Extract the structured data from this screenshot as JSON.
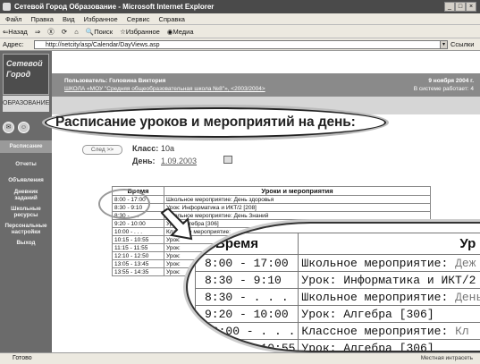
{
  "window": {
    "title": "Сетевой Город Образование - Microsoft Internet Explorer"
  },
  "menu": [
    "Файл",
    "Правка",
    "Вид",
    "Избранное",
    "Сервис",
    "Справка"
  ],
  "toolbar": [
    "⇐Назад",
    "⇒",
    "Ⓧ",
    "⟳",
    "⌂",
    "🔍Поиск",
    "☆Избранное",
    "◉Медиа"
  ],
  "address": {
    "label": "Адрес:",
    "url": "http://netcity/asp/Calendar/DayViews.asp",
    "links": "Ссылки"
  },
  "logo": {
    "line1": "Сетевой",
    "line2": "Город",
    "tab": "ОБРАЗОВАНИЕ"
  },
  "nav": [
    "Расписание",
    "Отчеты",
    "Объявления",
    "Дневник заданий",
    "Школьные ресурсы",
    "Персональные настройки",
    "Выход"
  ],
  "header": {
    "user": "Пользователь: Головина Виктория",
    "school": "ШКОЛА «МОУ \"Средняя общеобразовательная школа №8\"», <2003/2004>",
    "date": "9 ноября 2004 г.",
    "online": "В системе работает: 4"
  },
  "page": {
    "heading": "Расписание уроков и мероприятий на день:",
    "next": "След >>",
    "class_label": "Класс:",
    "class_value": "10а",
    "day_label": "День:",
    "day_value": "1.09.2003"
  },
  "small_table": {
    "headers": [
      "Время",
      "Уроки и мероприятия"
    ],
    "rows": [
      [
        "8:00 - 17:00",
        "Школьное мероприятие: День здоровья"
      ],
      [
        "8:30 - 9:10",
        "Урок: Информатика и ИКТ/2 [208]"
      ],
      [
        "8:30 - . . .",
        "Школьное мероприятие: День Знаний"
      ],
      [
        "9:20 - 10:00",
        "Урок: Алгебра [306]"
      ],
      [
        "10:00 - . . .",
        "Классное мероприятие:"
      ],
      [
        "10:15 - 10:55",
        "Урок:"
      ],
      [
        "11:15 - 11:55",
        "Урок:"
      ],
      [
        "12:10 - 12:50",
        "Урок:"
      ],
      [
        "13:05 - 13:45",
        "Урок:"
      ],
      [
        "13:55 - 14:35",
        "Урок:"
      ]
    ]
  },
  "zoom_table": {
    "headers": [
      "Время",
      "Ур"
    ],
    "rows": [
      [
        "8:00 - 17:00",
        "Школьное мероприятие: ",
        "Дeж"
      ],
      [
        "8:30 - 9:10",
        "Урок: Информатика и ИКТ/2 [2",
        ""
      ],
      [
        "8:30 - . . .",
        "Школьное мероприятие: ",
        "День З"
      ],
      [
        "9:20 - 10:00",
        "Урок: Алгебра [306]",
        ""
      ],
      [
        "10:00 - . . .",
        "Классное мероприятие: ",
        "Кл"
      ],
      [
        "10:15 - 10:55",
        "Урок: Алгебра [306]",
        ""
      ]
    ]
  },
  "status": {
    "text": "Готово",
    "zone": "Местная интрасеть"
  }
}
